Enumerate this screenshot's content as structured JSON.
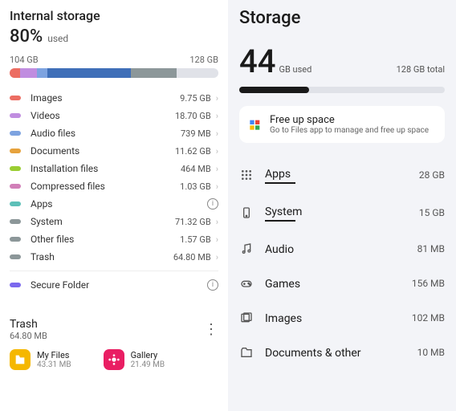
{
  "left": {
    "title": "Internal storage",
    "percent": "80%",
    "used_label": "used",
    "bar_used": "104 GB",
    "bar_total": "128 GB",
    "segments": [
      {
        "color": "#ec6d62",
        "w": 5
      },
      {
        "color": "#c08de0",
        "w": 8
      },
      {
        "color": "#7da3e0",
        "w": 5
      },
      {
        "color": "#3f6fb8",
        "w": 40
      },
      {
        "color": "#8c9799",
        "w": 22
      }
    ],
    "categories": [
      {
        "label": "Images",
        "size": "9.75 GB",
        "color": "#ec6d62",
        "chev": true
      },
      {
        "label": "Videos",
        "size": "18.70 GB",
        "color": "#c08de0",
        "chev": true
      },
      {
        "label": "Audio files",
        "size": "739 MB",
        "color": "#7da3e0",
        "chev": true
      },
      {
        "label": "Documents",
        "size": "11.62 GB",
        "color": "#e6a23c",
        "chev": true
      },
      {
        "label": "Installation files",
        "size": "464 MB",
        "color": "#9acd32",
        "chev": true
      },
      {
        "label": "Compressed files",
        "size": "1.03 GB",
        "color": "#d17fb8",
        "chev": true
      },
      {
        "label": "Apps",
        "size": "",
        "color": "#5cc0b8",
        "info": true
      },
      {
        "label": "System",
        "size": "71.32 GB",
        "color": "#8c9799",
        "chev": true
      },
      {
        "label": "Other files",
        "size": "1.57 GB",
        "color": "#8c9799",
        "chev": true
      },
      {
        "label": "Trash",
        "size": "64.80 MB",
        "color": "#8c9799",
        "chev": true
      }
    ],
    "secure": {
      "label": "Secure Folder",
      "color": "#7b68ee",
      "info": true
    },
    "trash": {
      "title": "Trash",
      "size": "64.80 MB"
    },
    "apps": [
      {
        "name": "My Files",
        "size": "43.31 MB",
        "bg": "#f5b700"
      },
      {
        "name": "Gallery",
        "size": "21.49 MB",
        "bg": "#e91e63"
      }
    ]
  },
  "right": {
    "title": "Storage",
    "big": "44",
    "gb_used": "GB used",
    "total": "128 GB total",
    "fill_pct": 34,
    "card": {
      "title": "Free up space",
      "sub": "Go to Files app to manage and free up space"
    },
    "rows": [
      {
        "icon": "grid",
        "label": "Apps",
        "size": "28 GB",
        "underline": true
      },
      {
        "icon": "system",
        "label": "System",
        "size": "15 GB",
        "underline": true
      },
      {
        "icon": "audio",
        "label": "Audio",
        "size": "81 MB"
      },
      {
        "icon": "games",
        "label": "Games",
        "size": "156 MB"
      },
      {
        "icon": "images",
        "label": "Images",
        "size": "102 MB"
      },
      {
        "icon": "docs",
        "label": "Documents & other",
        "size": "10 MB"
      }
    ]
  }
}
